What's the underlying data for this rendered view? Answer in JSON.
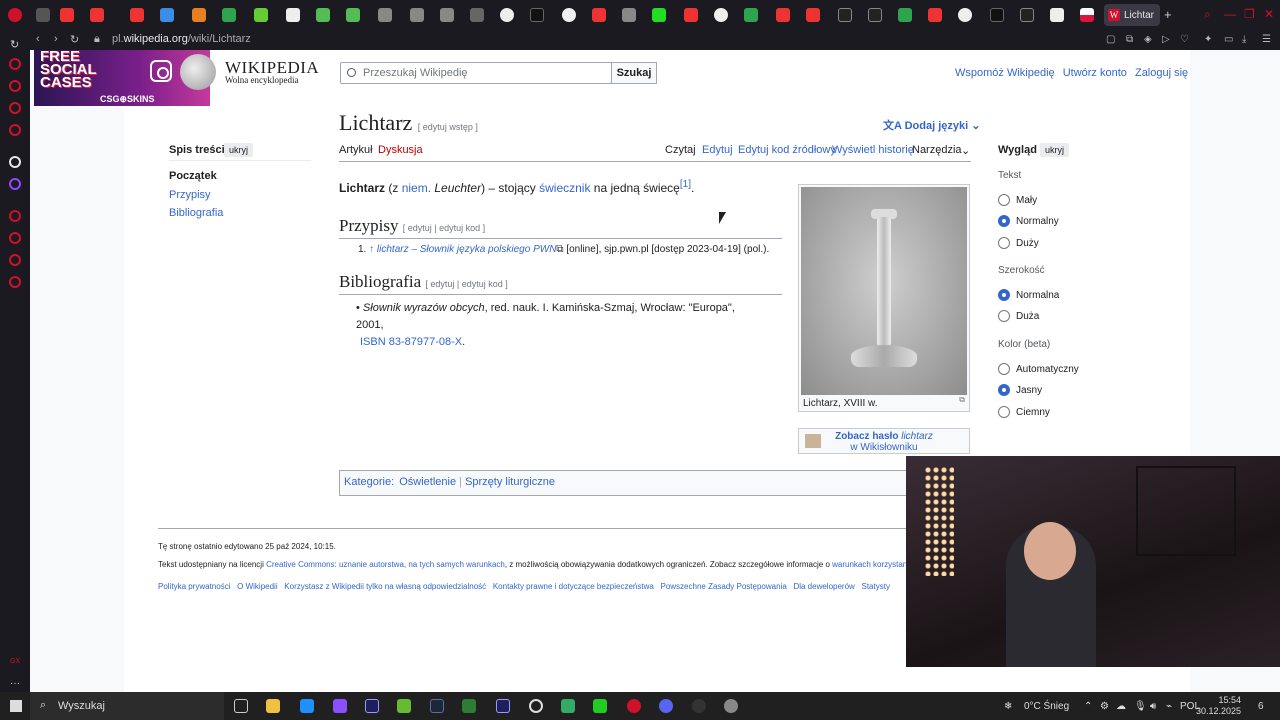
{
  "browser": {
    "active_tab": "Lichtar",
    "url_prefix": "pl.",
    "url_domain": "wikipedia.org",
    "url_path": "/wiki/Lichtarz"
  },
  "ad": {
    "line1": "FREE",
    "line2": "SOCIAL",
    "line3": "CASES",
    "brand": "CSG⊕SKINS"
  },
  "header": {
    "wiki_name": "WIKIPEDIA",
    "wiki_tagline": "Wolna encyklopedia",
    "search_placeholder": "Przeszukaj Wikipedię",
    "search_button": "Szukaj",
    "links": [
      "Wspomóż Wikipedię",
      "Utwórz konto",
      "Zaloguj się"
    ]
  },
  "toc": {
    "title": "Spis treści",
    "hide": "ukryj",
    "items": [
      "Początek",
      "Przypisy",
      "Bibliografia"
    ]
  },
  "article": {
    "title": "Lichtarz",
    "edit_intro": "[ edytuj wstęp ]",
    "add_languages": "Dodaj języki",
    "tabs_left": [
      "Artykuł",
      "Dyskusja"
    ],
    "tabs_right": [
      "Czytaj",
      "Edytuj",
      "Edytuj kod źródłowy",
      "Wyświetl historię",
      "Narzędzia"
    ],
    "lead_bold": "Lichtarz",
    "lead_p1": " (z ",
    "lead_link1": "niem.",
    "lead_italic": " Leuchter",
    "lead_p2": ") – stojący ",
    "lead_link2": "świecznik",
    "lead_p3": " na jedną świecę",
    "lead_ref": "[1]",
    "section_refs": "Przypisy",
    "section_bib": "Bibliografia",
    "section_edit": "[ edytuj | edytuj kod ]",
    "ref_number": "1.",
    "ref_arrow": "↑",
    "ref_link": "lichtarz – Słownik języka polskiego PWN",
    "ref_rest": " [online], sjp.pwn.pl [dostęp 2023-04-19] (pol.).",
    "bib_italic": "Słownik wyrazów obcych",
    "bib_rest": ", red. nauk. I. Kamińska-Szmaj, Wrocław: \"Europa\", 2001,",
    "bib_isbn": "ISBN 83-87977-08-X",
    "infobox_caption": "Lichtarz, XVIII w.",
    "wiktionary_line1": "Zobacz hasło ",
    "wiktionary_word": "lichtarz",
    "wiktionary_line2": "w Wikisłowniku",
    "categories_label": "Kategorie:",
    "categories": [
      "Oświetlenie",
      "Sprzęty liturgiczne"
    ]
  },
  "footer": {
    "last_edit": "Tę stronę ostatnio edytowano 25 paź 2024, 10:15.",
    "license_p1": "Tekst udostępniany na licencji ",
    "license_link": "Creative Commons: uznanie autorstwa, na tych samych warunkach",
    "license_p2": ", z możliwością obowiązywania dodatkowych ograniczeń. Zobacz szczegółowe informacje o ",
    "license_link2": "warunkach korzystan",
    "links": [
      "Polityka prywatności",
      "O Wikipedii",
      "Korzystasz z Wikipedii tylko na własną odpowiedzialność",
      "Kontakty prawne i dotyczące bezpieczeństwa",
      "Powszechne Zasady Postępowania",
      "Dla deweloperów",
      "Statysty"
    ]
  },
  "appearance": {
    "title": "Wygląd",
    "hide": "ukryj",
    "text_label": "Tekst",
    "text_options": [
      "Mały",
      "Normalny",
      "Duży"
    ],
    "width_label": "Szerokość",
    "width_options": [
      "Normalna",
      "Duża"
    ],
    "color_label": "Kolor (beta)",
    "color_options": [
      "Automatyczny",
      "Jasny",
      "Ciemny"
    ]
  },
  "taskbar": {
    "search": "Wyszukaj",
    "weather": "0°C  Śnieg",
    "lang": "POL",
    "time": "15:54",
    "date": "30.12.2025",
    "notif": "6"
  },
  "colors": {
    "link": "#3366cc",
    "red_link": "#ba0000",
    "accent": "#d0112b"
  }
}
